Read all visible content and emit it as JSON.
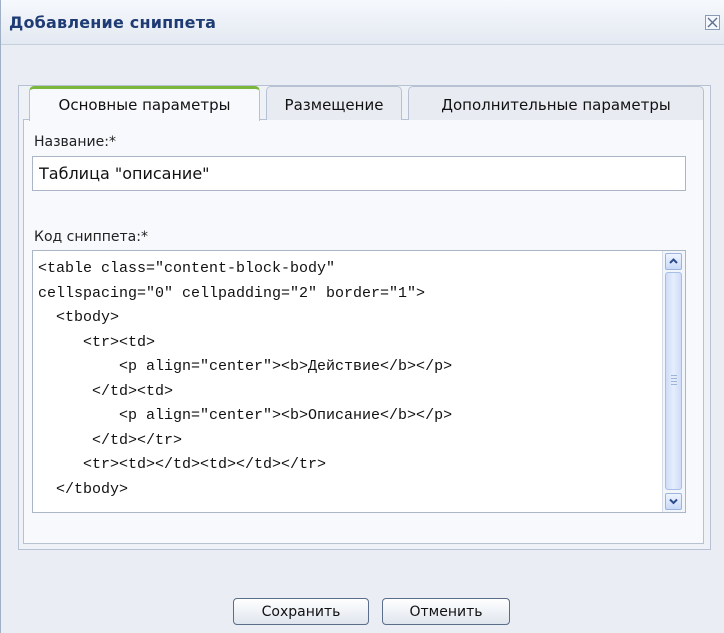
{
  "dialog": {
    "title": "Добавление сниппета",
    "close_icon": "close-icon"
  },
  "tabs": [
    {
      "label": "Основные параметры",
      "active": true
    },
    {
      "label": "Размещение",
      "active": false
    },
    {
      "label": "Дополнительные параметры",
      "active": false
    }
  ],
  "form": {
    "name_label": "Название:*",
    "name_value": "Таблица \"описание\"",
    "code_label": "Код сниппета:*",
    "code_value": "<table class=\"content-block-body\"\ncellspacing=\"0\" cellpadding=\"2\" border=\"1\">\n  <tbody>\n     <tr><td>\n         <p align=\"center\"><b>Действие</b></p>\n      </td><td>\n         <p align=\"center\"><b>Описание</b></p>\n      </td></tr>\n     <tr><td></td><td></td></tr>\n  </tbody>"
  },
  "buttons": {
    "save_label": "Сохранить",
    "cancel_label": "Отменить"
  },
  "colors": {
    "title_text": "#1f3b73",
    "active_tab_accent": "#7ab73a",
    "panel_background": "#eaeef4"
  }
}
